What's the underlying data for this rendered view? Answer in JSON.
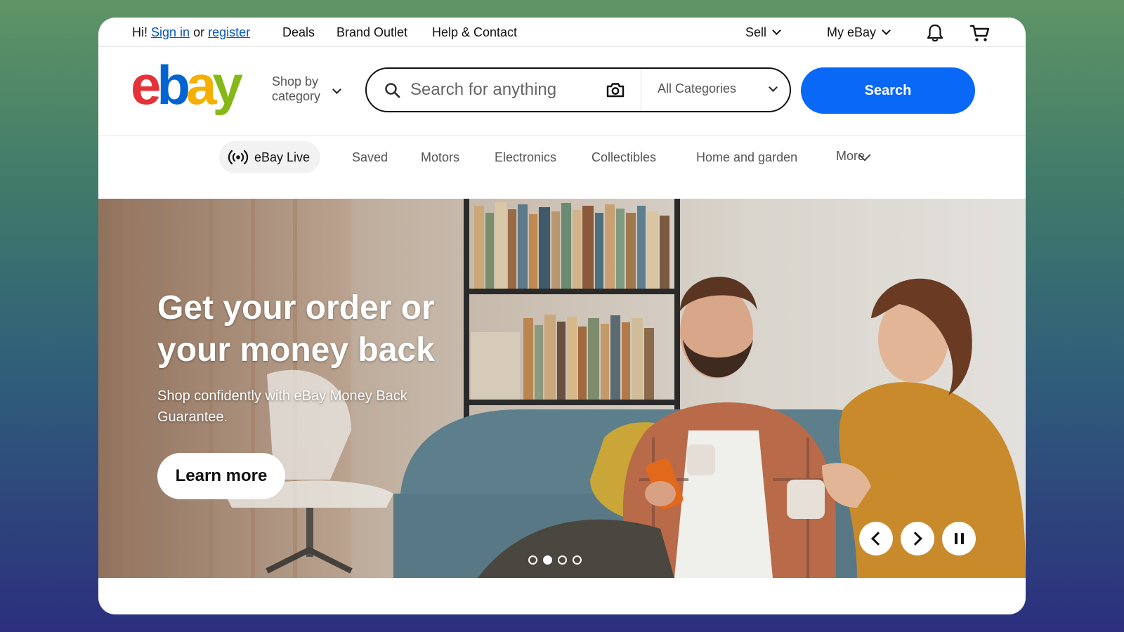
{
  "topbar": {
    "greeting_prefix": "Hi!",
    "sign_in": "Sign in",
    "or": "or",
    "register": "register",
    "deals": "Deals",
    "brand_outlet": "Brand Outlet",
    "help_contact": "Help & Contact",
    "sell": "Sell",
    "my_ebay": "My eBay"
  },
  "header": {
    "logo_letters": [
      "e",
      "b",
      "a",
      "y"
    ],
    "shop_by_line1": "Shop by",
    "shop_by_line2": "category",
    "search_placeholder": "Search for anything",
    "category_selected": "All Categories",
    "search_button": "Search"
  },
  "nav": {
    "live": "eBay Live",
    "items": [
      "Saved",
      "Motors",
      "Electronics",
      "Collectibles",
      "Home and garden",
      "More"
    ]
  },
  "hero": {
    "title": "Get your order or your money back",
    "subtitle": "Shop confidently with eBay Money Back Guarantee.",
    "cta": "Learn more",
    "slide_count": 4,
    "active_slide": 2
  },
  "colors": {
    "search_button": "#0968f6",
    "link": "#0654ba",
    "logo_e": "#e53238",
    "logo_b": "#0064d2",
    "logo_a": "#f5af02",
    "logo_y": "#86b817"
  },
  "icons": [
    "bell-icon",
    "cart-icon",
    "search-icon",
    "camera-icon",
    "live-broadcast-icon",
    "chevron-left-icon",
    "chevron-right-icon",
    "pause-icon"
  ]
}
